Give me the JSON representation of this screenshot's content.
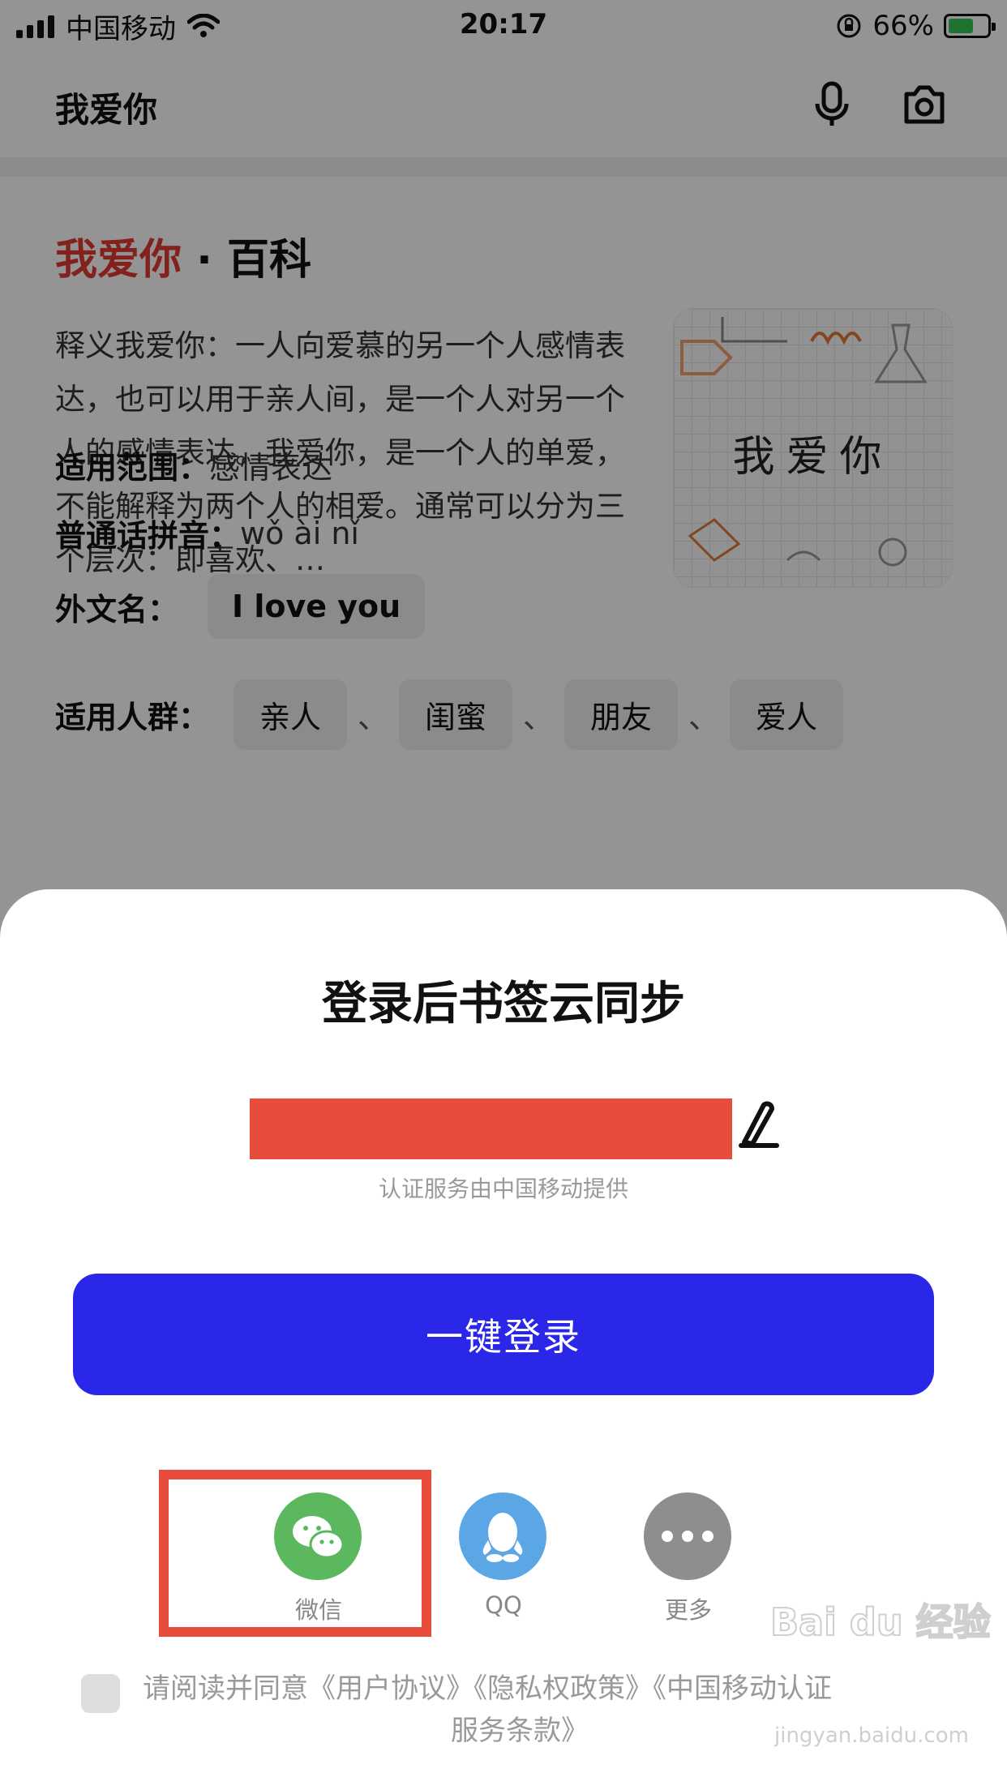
{
  "status_bar": {
    "carrier": "中国移动",
    "time": "20:17",
    "battery": "66%"
  },
  "search": {
    "query": "我爱你"
  },
  "encyclopedia": {
    "title_highlight": "我爱你",
    "title_rest": " · 百科",
    "description": "释义我爱你：一人向爱慕的另一个人感情表达，也可以用于亲人间，是一个人对另一个人的感情表达。我爱你，是一个人的单爱，不能解释为两个人的相爱。通常可以分为三个层次：即喜欢、…",
    "image_text": "我爱你",
    "scope_label": "适用范围：",
    "scope_value": "感情表达",
    "pinyin_label": "普通话拼音：",
    "pinyin_value": "wǒ ài nǐ",
    "foreign_label": "外文名：",
    "foreign_value": "I love you",
    "people_label": "适用人群：",
    "people": [
      "亲人",
      "闺蜜",
      "朋友",
      "爱人"
    ],
    "people_sep": "、"
  },
  "login_sheet": {
    "title": "登录后书签云同步",
    "auth_note": "认证服务由中国移动提供",
    "login_button": "一键登录",
    "providers": [
      {
        "label": "微信",
        "icon": "wechat-icon"
      },
      {
        "label": "QQ",
        "icon": "qq-icon"
      },
      {
        "label": "更多",
        "icon": "more-dots-icon"
      }
    ],
    "agreement_line1": "请阅读并同意《用户协议》《隐私权政策》《中国移动认证",
    "agreement_line2": "服务条款》"
  },
  "watermark": {
    "brand": "Bai du 经验",
    "url": "jingyan.baidu.com"
  },
  "colors": {
    "accent_red": "#e23a33",
    "login_blue": "#2b27e8",
    "wechat_green": "#5bb85e",
    "qq_blue": "#5ba7e6",
    "highlight_box": "#e84c3d"
  }
}
